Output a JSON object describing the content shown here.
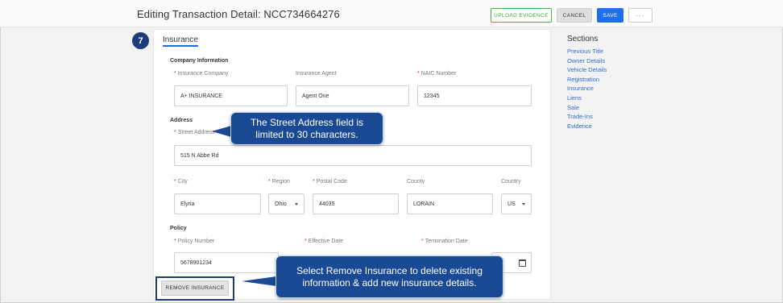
{
  "header": {
    "title": "Editing Transaction Detail: NCC734664276",
    "upload_label": "UPLOAD EVIDENCE",
    "cancel_label": "CANCEL",
    "save_label": "SAVE",
    "more_label": "···"
  },
  "section": {
    "step_number": "7",
    "title": "Insurance"
  },
  "company": {
    "heading": "Company Information",
    "insurance_company_label": "Insurance Company",
    "insurance_company_value": "A+ INSURANCE",
    "agent_label": "Insurance Agent",
    "agent_value": "Agent One",
    "naic_label": "NAIC Number",
    "naic_value": "12345"
  },
  "address": {
    "heading": "Address",
    "street_label": "Street Address",
    "street_value": "515 N Abbe Rd",
    "city_label": "City",
    "city_value": "Elyria",
    "region_label": "Region",
    "region_value": "Ohio",
    "postal_label": "Postal Code",
    "postal_value": "44035",
    "county_label": "County",
    "county_value": "LORAIN",
    "country_label": "Country",
    "country_value": "US"
  },
  "policy": {
    "heading": "Policy",
    "number_label": "Policy Number",
    "number_value": "5678901234",
    "effective_label": "Effective Date",
    "termination_label": "Termination Date"
  },
  "remove_label": "REMOVE INSURANCE",
  "sidebar": {
    "title": "Sections",
    "items": [
      {
        "label": "Previous Title"
      },
      {
        "label": "Owner Details"
      },
      {
        "label": "Vehicle Details"
      },
      {
        "label": "Registration"
      },
      {
        "label": "Insurance"
      },
      {
        "label": "Liens"
      },
      {
        "label": "Sale"
      },
      {
        "label": "Trade-Ins"
      },
      {
        "label": "Evidence"
      }
    ]
  },
  "callouts": {
    "street": "The Street Address field is limited to 30 characters.",
    "remove": "Select Remove Insurance to delete existing information & add new insurance details."
  },
  "icons": {
    "date": "calendar-icon",
    "select": "chevron-down-icon"
  },
  "colors": {
    "primary": "#1e6ff0",
    "callout": "#1b4a94",
    "success": "#42b742",
    "required": "#e0322f"
  }
}
